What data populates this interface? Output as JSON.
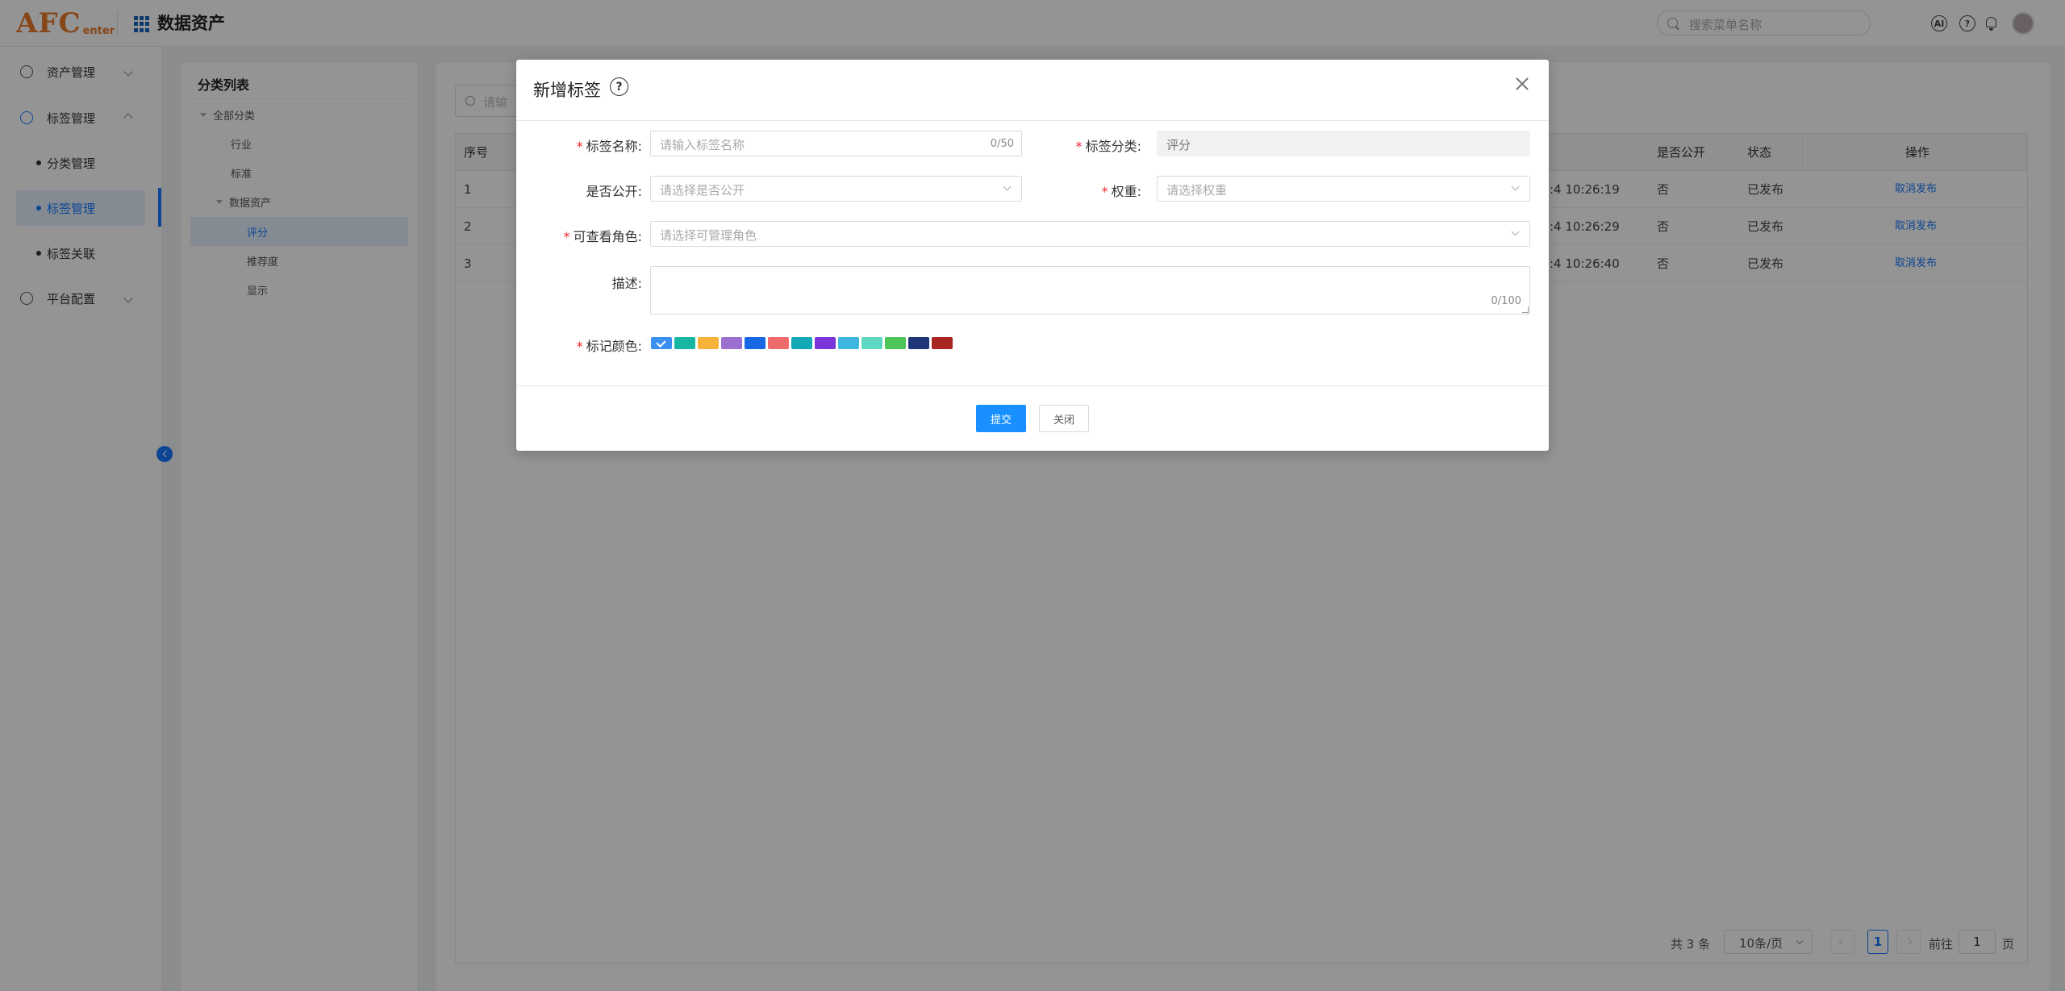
{
  "header": {
    "logo_main": "AFC",
    "logo_sub": "enter",
    "title": "数据资产",
    "search_placeholder": "搜索菜单名称",
    "ai_icon_text": "AI",
    "help_icon_text": "?"
  },
  "sidebar": {
    "menu": [
      {
        "label": "资产管理",
        "icon": "clock-icon"
      },
      {
        "label": "标签管理",
        "icon": "plus-circle-icon"
      },
      {
        "label": "平台配置",
        "icon": "gear-icon"
      }
    ],
    "sub_items": [
      {
        "label": "分类管理"
      },
      {
        "label": "标签管理",
        "active": true
      },
      {
        "label": "标签关联"
      }
    ]
  },
  "category_panel": {
    "title": "分类列表",
    "tree": [
      {
        "label": "全部分类"
      },
      {
        "label": "行业"
      },
      {
        "label": "标准"
      },
      {
        "label": "数据资产"
      },
      {
        "label": "评分",
        "selected": true
      },
      {
        "label": "推荐度"
      },
      {
        "label": "显示"
      }
    ]
  },
  "main": {
    "search_placeholder": "请输",
    "table": {
      "headers": {
        "index": "序号",
        "public": "是否公开",
        "status": "状态",
        "action": "操作"
      },
      "rows": [
        {
          "index": "1",
          "time": ":4 10:26:19",
          "public": "否",
          "status": "已发布",
          "action": "取消发布"
        },
        {
          "index": "2",
          "time": ":4 10:26:29",
          "public": "否",
          "status": "已发布",
          "action": "取消发布"
        },
        {
          "index": "3",
          "time": ":4 10:26:40",
          "public": "否",
          "status": "已发布",
          "action": "取消发布"
        }
      ]
    },
    "pager": {
      "total": "共 3 条",
      "page_size": "10条/页",
      "current_page": "1",
      "goto_label": "前往",
      "goto_value": "1",
      "page_suffix": "页"
    }
  },
  "modal": {
    "title": "新增标签",
    "help_icon_text": "?",
    "fields": {
      "name_label": "标签名称:",
      "name_placeholder": "请输入标签名称",
      "name_count": "0/50",
      "category_label": "标签分类:",
      "category_value": "评分",
      "public_label": "是否公开:",
      "public_placeholder": "请选择是否公开",
      "weight_label": "权重:",
      "weight_placeholder": "请选择权重",
      "roles_label": "可查看角色:",
      "roles_placeholder": "请选择可管理角色",
      "desc_label": "描述:",
      "desc_count": "0/100",
      "color_label": "标记颜色:"
    },
    "colors": [
      "#3b8ff0",
      "#17b7a3",
      "#f7b23a",
      "#9b6fd0",
      "#1668e3",
      "#ee6b6b",
      "#12a8b5",
      "#7b36d9",
      "#3fb6e0",
      "#5ed8c0",
      "#4cc657",
      "#1f3577",
      "#a8251f"
    ],
    "selected_color_index": 0,
    "submit_label": "提交",
    "close_label": "关闭"
  }
}
